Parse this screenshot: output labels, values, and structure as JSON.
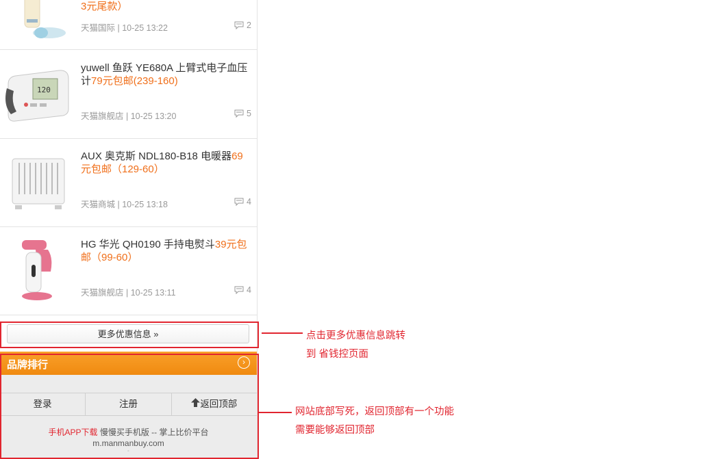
{
  "products": [
    {
      "title": "",
      "price": "3元尾款）",
      "shop": "天猫国际",
      "time": "10-25 13:22",
      "comments": "2"
    },
    {
      "title": "yuwell 鱼跃 YE680A 上臂式电子血压计",
      "price": "79元包邮(239-160)",
      "shop": "天猫旗舰店",
      "time": "10-25 13:20",
      "comments": "5"
    },
    {
      "title": "AUX 奥克斯 NDL180-B18 电暖器",
      "price": "69元包邮（129-60）",
      "shop": "天猫商城",
      "time": "10-25 13:18",
      "comments": "4"
    },
    {
      "title": "HG 华光 QH0190 手持电熨斗",
      "price": "39元包邮（99-60）",
      "shop": "天猫旗舰店",
      "time": "10-25 13:11",
      "comments": "4"
    }
  ],
  "more_button": "更多优惠信息 »",
  "brand_ranking": {
    "label": "品牌排行"
  },
  "footer": {
    "nav": {
      "login": "登录",
      "register": "注册",
      "back_to_top": "返回顶部"
    },
    "app_link": "手机APP下载",
    "mobile_label": "慢慢买手机版",
    "slogan_sep": "--",
    "slogan": "掌上比价平台",
    "domain": "m.manmanbuy.com"
  },
  "annotations": {
    "more_note_line1": "点击更多优惠信息跳转",
    "more_note_line2": "到 省钱控页面",
    "footer_note_line1": "网站底部写死，返回顶部有一个功能",
    "footer_note_line2": "需要能够返回顶部"
  },
  "meta_separator": "|",
  "colors": {
    "price": "#f06f1a",
    "annotation": "#e1252f",
    "brand_bar": "#f49516"
  }
}
